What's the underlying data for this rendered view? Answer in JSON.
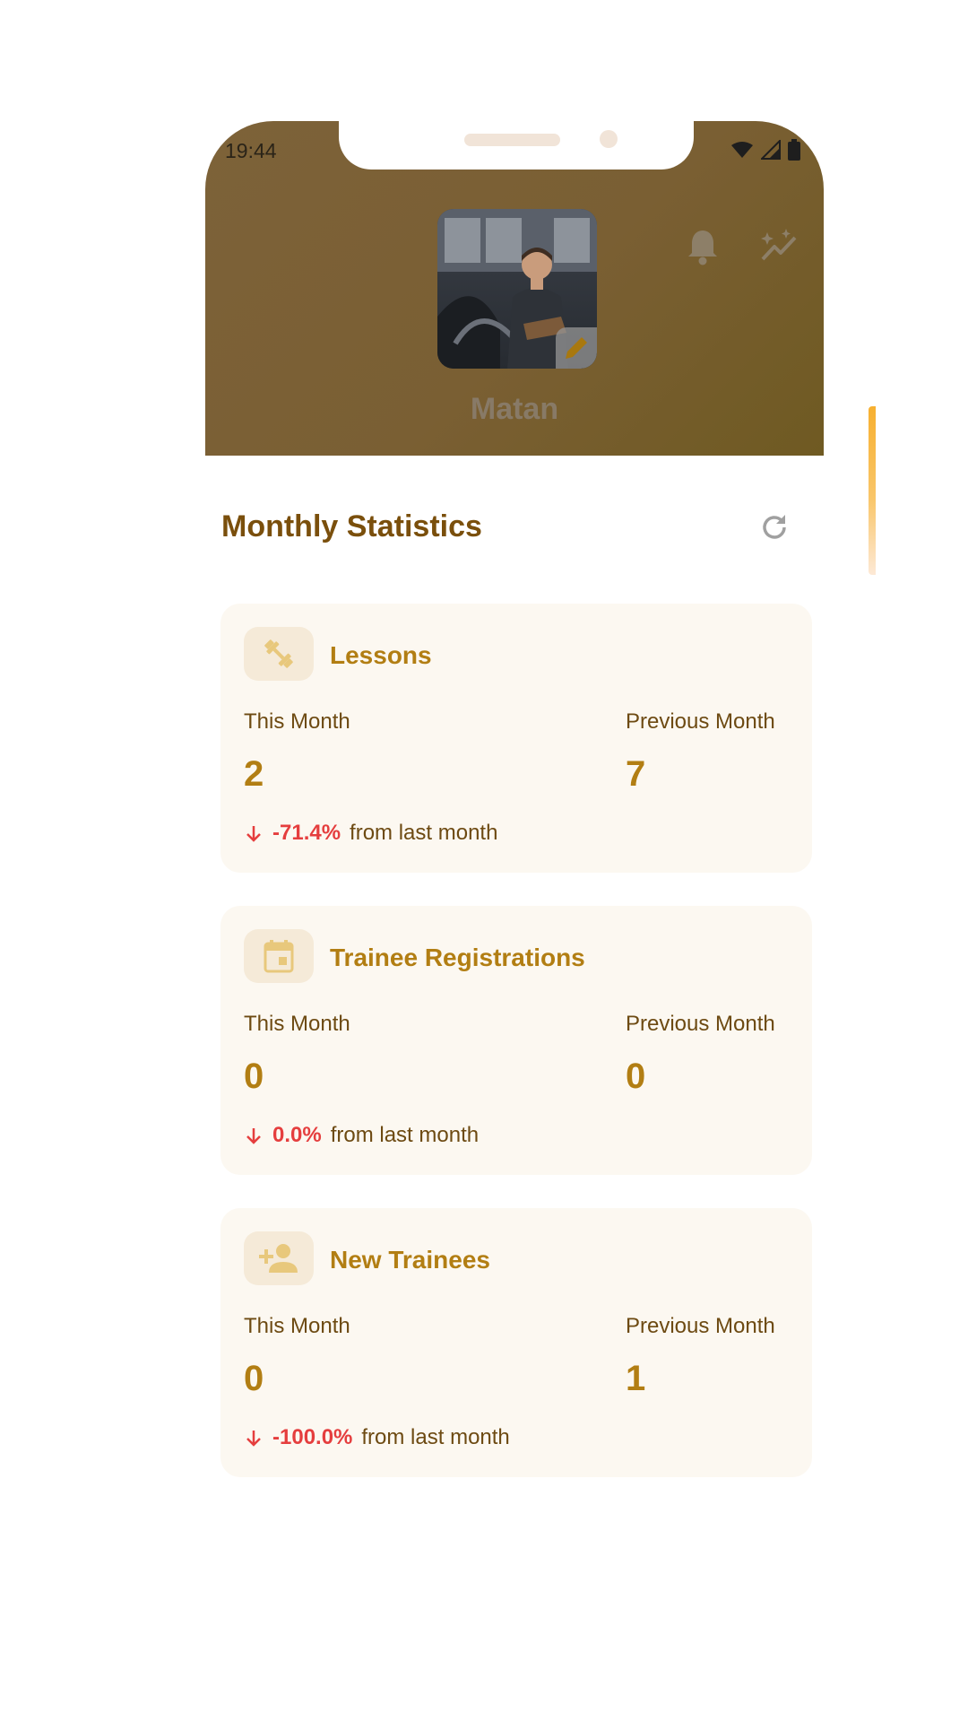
{
  "status_bar": {
    "time": "19:44"
  },
  "profile": {
    "name": "Matan"
  },
  "stats": {
    "title": "Monthly Statistics",
    "cards": [
      {
        "title": "Lessons",
        "icon": "dumbbell-icon",
        "this_month_label": "This Month",
        "this_month": "2",
        "prev_month_label": "Previous Month",
        "prev_month": "7",
        "change": "-71.4%",
        "change_suffix": "from last month"
      },
      {
        "title": "Trainee Registrations",
        "icon": "calendar-icon",
        "this_month_label": "This Month",
        "this_month": "0",
        "prev_month_label": "Previous Month",
        "prev_month": "0",
        "change": "0.0%",
        "change_suffix": "from last month"
      },
      {
        "title": "New Trainees",
        "icon": "person-add-icon",
        "this_month_label": "This Month",
        "this_month": "0",
        "prev_month_label": "Previous Month",
        "prev_month": "1",
        "change": "-100.0%",
        "change_suffix": "from last month"
      }
    ]
  },
  "colors": {
    "accent": "#b27e13",
    "title": "#7a4f0c",
    "negative": "#e53e3e",
    "card_bg": "#fcf8f1",
    "header": "#7a5f33"
  }
}
